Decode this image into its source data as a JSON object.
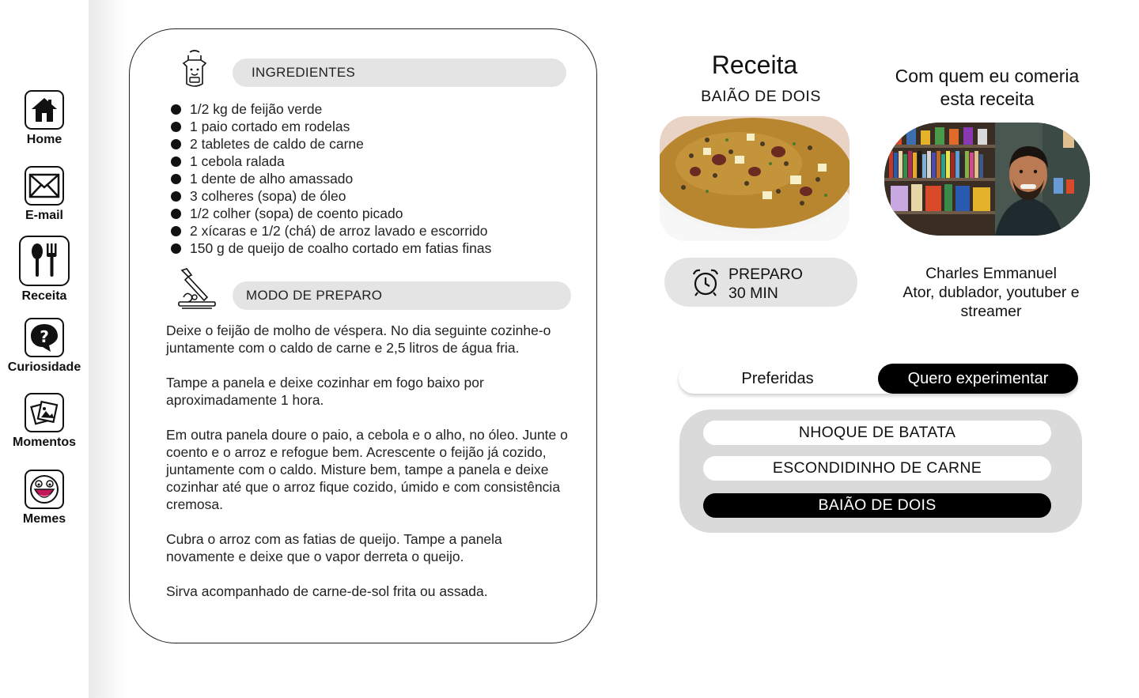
{
  "nav": {
    "home": "Home",
    "email": "E-mail",
    "receita": "Receita",
    "curiosidade": "Curiosidade",
    "momentos": "Momentos",
    "memes": "Memes"
  },
  "card": {
    "ingredients_header": "INGREDIENTES",
    "ingredients": [
      "1/2 kg de feijão verde",
      "1 paio cortado em rodelas",
      "2 tabletes de caldo de carne",
      "1 cebola ralada",
      "1 dente de alho amassado",
      "3 colheres (sopa) de óleo",
      "1/2 colher (sopa) de coento picado",
      "2 xícaras e 1/2 (chá) de arroz lavado e escorrido",
      "150 g de queijo de coalho cortado em fatias finas"
    ],
    "method_header": "MODO DE PREPARO",
    "method": [
      "Deixe o feijão de molho de véspera. No dia seguinte cozinhe-o juntamente com o caldo de carne e 2,5 litros de água fria.",
      "Tampe a panela e deixe cozinhar em fogo baixo por aproximadamente 1 hora.",
      "Em outra panela doure o paio, a cebola e o alho, no óleo. Junte o coento e o arroz e refogue bem. Acrescente o feijão já cozido, juntamente com o caldo. Misture bem, tampe a panela e deixe cozinhar até que o arroz fique cozido, úmido e com consistência cremosa.",
      "Cubra o arroz com as fatias de queijo. Tampe a panela novamente e deixe que o vapor derreta o queijo.",
      "Sirva acompanhado de carne-de-sol frita ou assada."
    ]
  },
  "recipe": {
    "title": "Receita",
    "name": "BAIÃO DE DOIS",
    "prep_label": "PREPARO",
    "prep_time": "30 MIN"
  },
  "person": {
    "title": "Com quem eu comeria esta receita",
    "name": "Charles Emmanuel",
    "description": "Ator, dublador, youtuber e streamer"
  },
  "tabs": {
    "preferidas": "Preferidas",
    "quero": "Quero experimentar"
  },
  "wishlist": [
    "NHOQUE DE BATATA",
    "ESCONDIDINHO DE CARNE",
    "BAIÃO DE DOIS"
  ]
}
